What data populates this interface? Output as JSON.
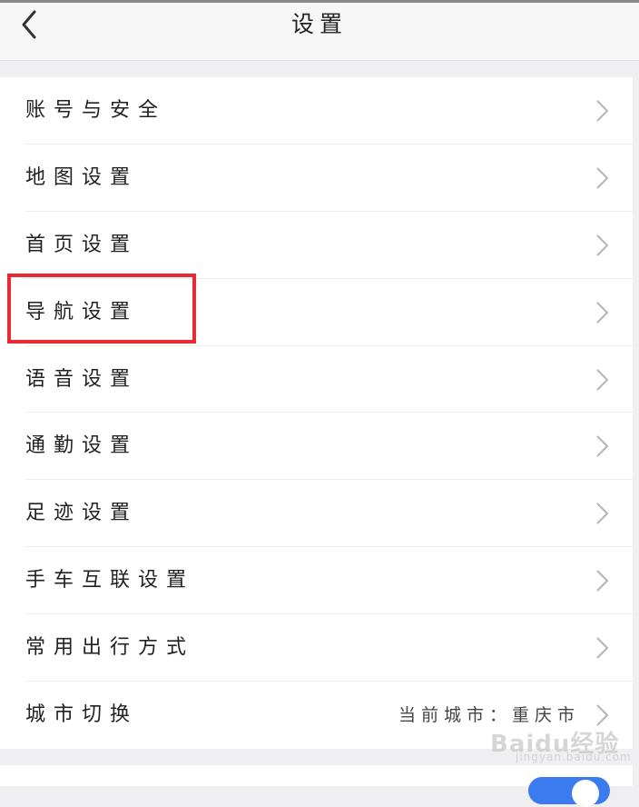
{
  "header": {
    "title": "设置",
    "back_icon": "chevron-left-icon"
  },
  "menu": {
    "items": [
      {
        "label": "账号与安全"
      },
      {
        "label": "地图设置"
      },
      {
        "label": "首页设置"
      },
      {
        "label": "导航设置",
        "highlighted": true
      },
      {
        "label": "语音设置"
      },
      {
        "label": "通勤设置"
      },
      {
        "label": "足迹设置"
      },
      {
        "label": "手车互联设置"
      },
      {
        "label": "常用出行方式"
      },
      {
        "label": "城市切换",
        "value": "当前城市：重庆市"
      }
    ]
  },
  "colors": {
    "highlight_border": "#ea2a33",
    "toggle_on": "#3a7bf0"
  },
  "watermark": {
    "main": "Baidu经验",
    "sub": "jingyan.baidu.com"
  }
}
